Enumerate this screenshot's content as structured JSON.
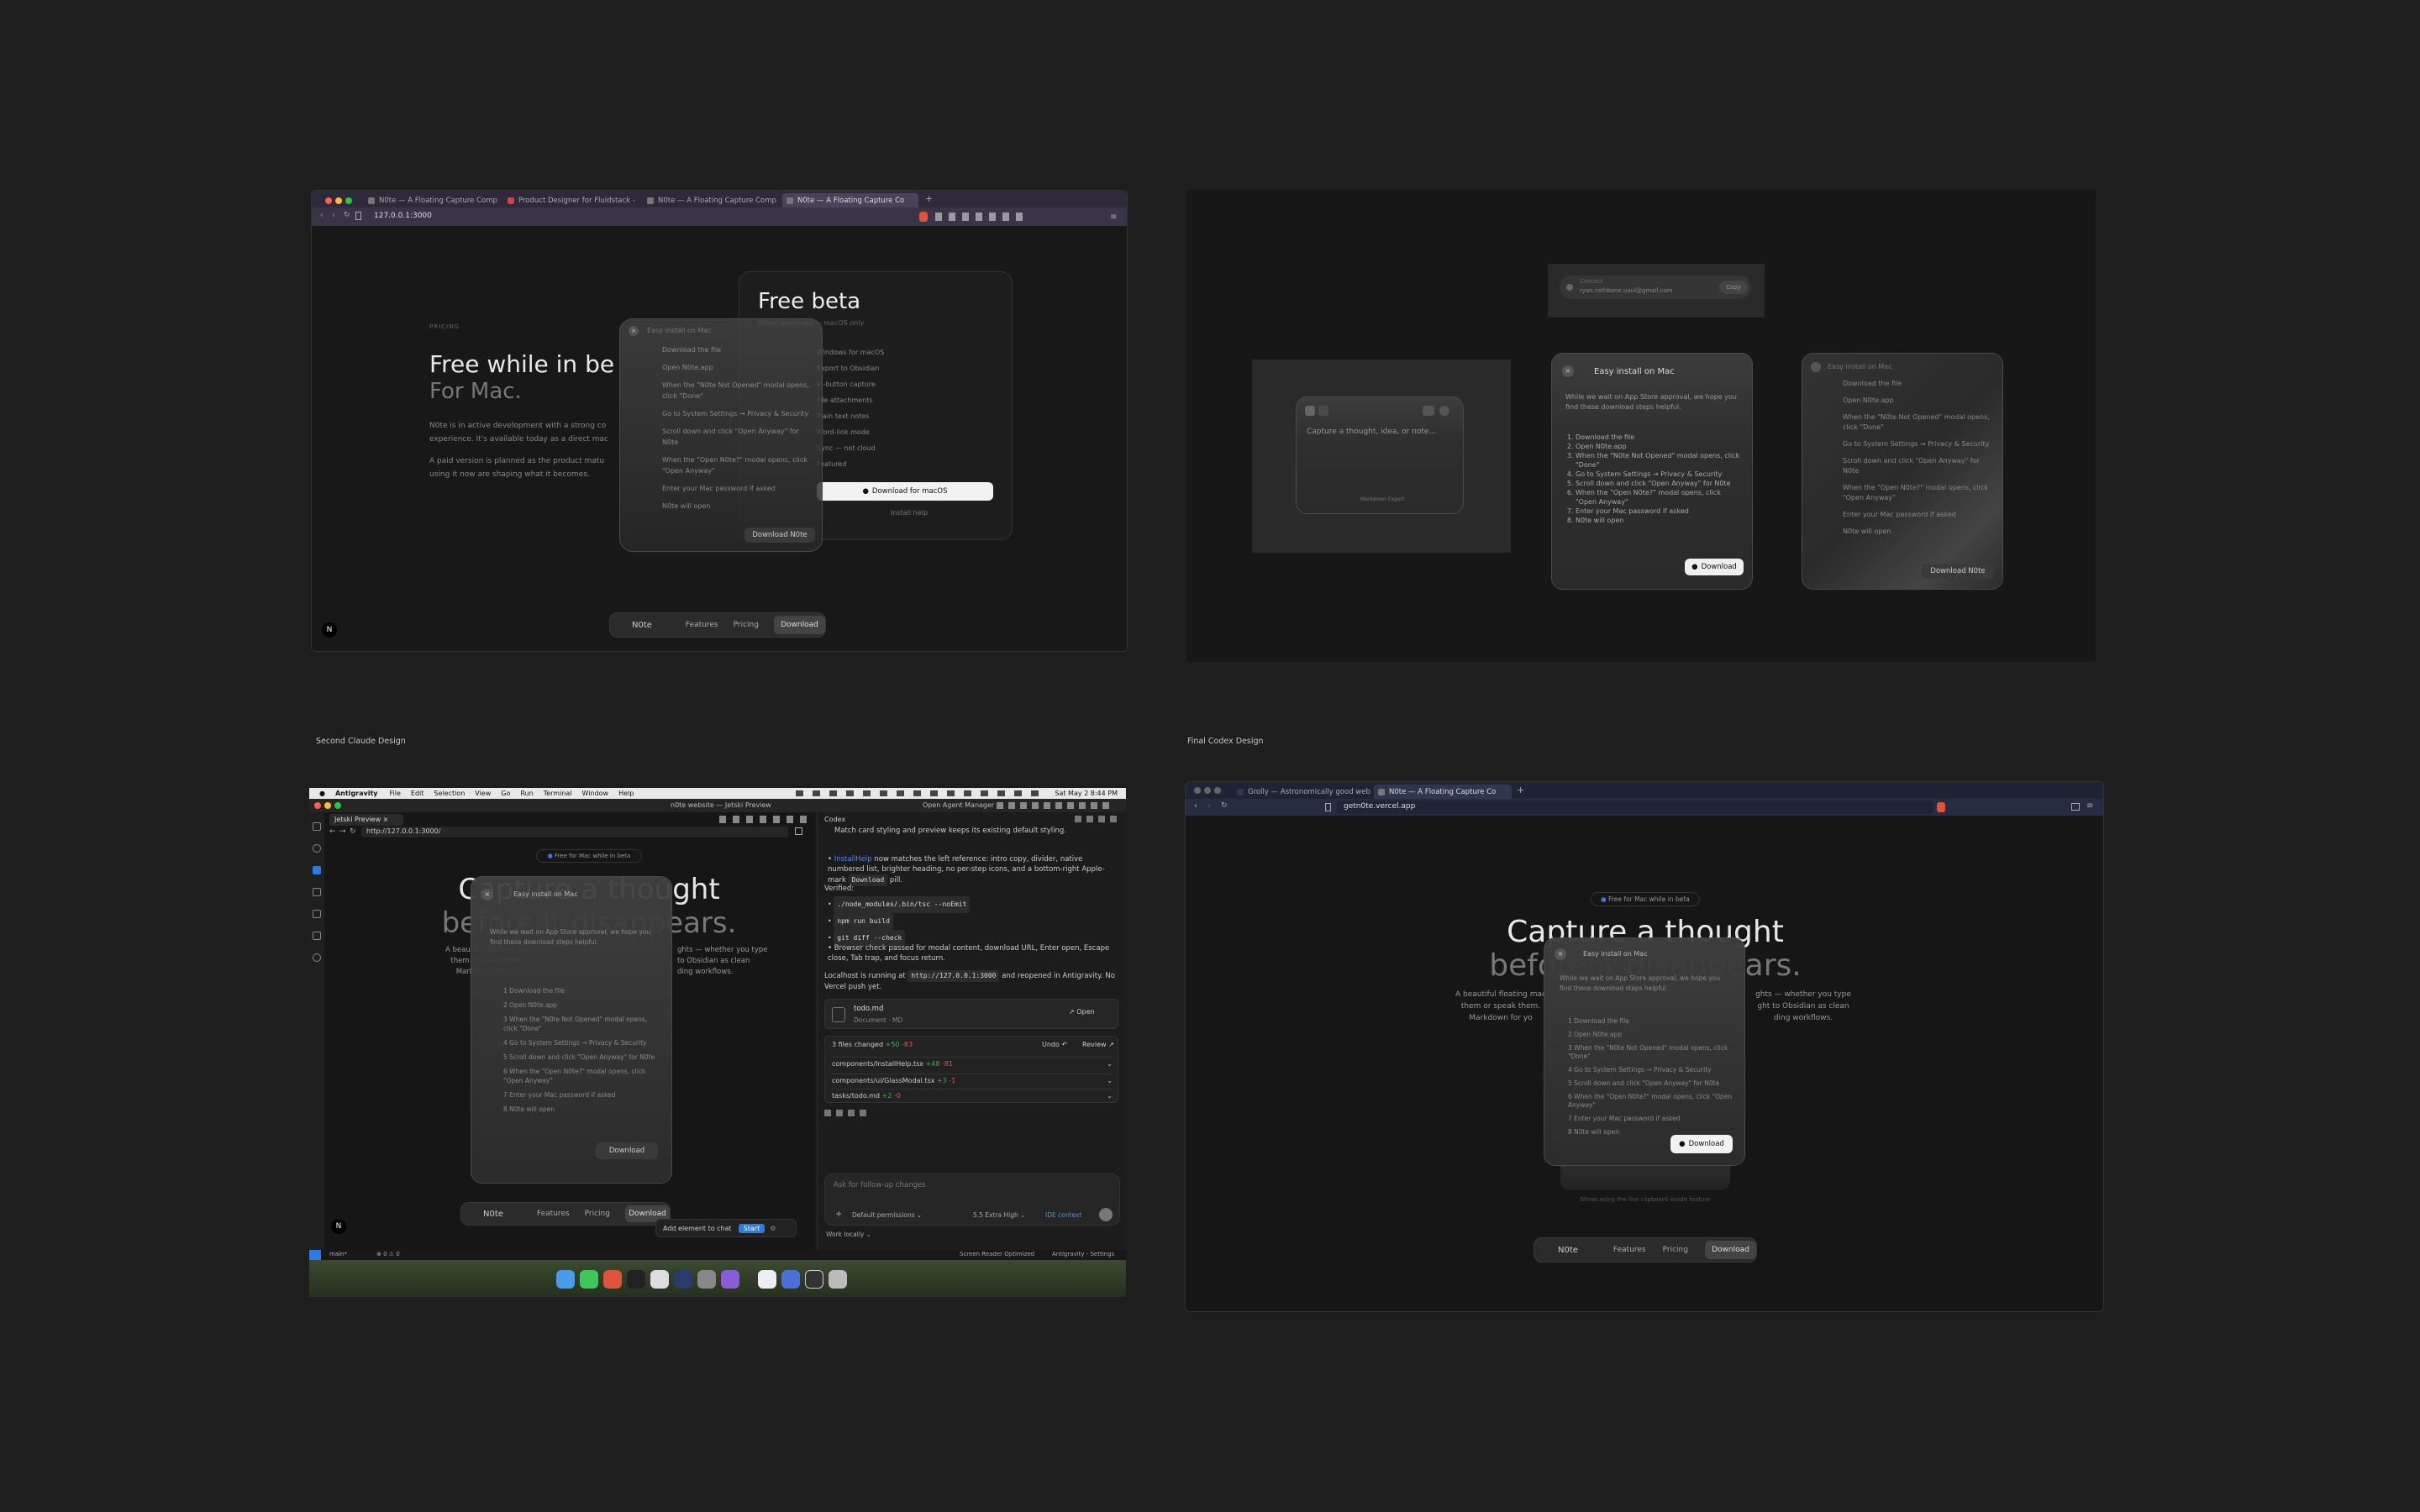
{
  "captions": {
    "second_claude": "Second Claude Design",
    "final_codex": "Final Codex Design"
  },
  "panel1": {
    "tabs": [
      "N0te — A Floating Capture Comp",
      "Product Designer for Fluidstack -",
      "N0te — A Floating Capture Comp",
      "N0te — A Floating Capture Co"
    ],
    "url": "127.0.0.1:3000",
    "eyebrow": "PRICING",
    "headline": "Free while in be",
    "subheadline": "For Mac.",
    "body1": "N0te is in active development with a strong co",
    "body1b": "experience. It's available today as a direct mac",
    "body2": "A paid version is planned as the product matu",
    "body2b": "using it now are shaping what it becomes.",
    "card_title": "Free beta",
    "card_sub": "Direct download — macOS only",
    "card_features": [
      "Windows for macOS",
      "Export to Obsidian",
      "In-button capture",
      "File attachments",
      "Plain text notes",
      "Word-link mode",
      "Sync — not cloud",
      "Featured"
    ],
    "card_download": "Download for macOS",
    "card_install": "Install help",
    "overlay_title": "Easy install on Mac",
    "overlay_steps": [
      "Download the file",
      "Open N0te.app",
      "When the \"N0te Not Opened\" modal opens, click \"Done\"",
      "Go to System Settings → Privacy & Security",
      "Scroll down and click \"Open Anyway\" for N0te",
      "When the \"Open N0te?\" modal opens, click \"Open Anyway\"",
      "Enter your Mac password if asked",
      "N0te will open"
    ],
    "overlay_button": "Download N0te",
    "nav": {
      "logo": "N0te",
      "features": "Features",
      "pricing": "Pricing",
      "download": "Download"
    },
    "badge": "N"
  },
  "panel2": {
    "email_label": "Contact",
    "email": "ryan.rathbone.uxui@gmail.com",
    "copy": "Copy",
    "capture_placeholder": "Capture a thought, idea, or note...",
    "capture_footer": "Markdown Export",
    "modal_title": "Easy install on Mac",
    "modal_intro": "While we wait on App Store approval, we hope you find these download steps helpful.",
    "modal_steps": [
      "Download the file",
      "Open N0te.app",
      "When the \"N0te Not Opened\" modal opens, click \"Done\"",
      "Go to System Settings → Privacy & Security",
      "Scroll down and click \"Open Anyway\" for N0te",
      "When the \"Open N0te?\" modal opens, click \"Open Anyway\"",
      "Enter your Mac password if asked",
      "N0te will open"
    ],
    "modal_button": "Download",
    "side_title": "Easy install on Mac",
    "side_steps": [
      "Download the file",
      "Open N0te.app",
      "When the \"N0te Not Opened\" modal opens, click \"Done\"",
      "Go to System Settings → Privacy & Security",
      "Scroll down and click \"Open Anyway\" for N0te",
      "When the \"Open N0te?\" modal opens, click \"Open Anyway\"",
      "Enter your Mac password if asked",
      "N0te will open"
    ],
    "side_button": "Download N0te"
  },
  "panel3": {
    "menubar": {
      "app": "Antigravity",
      "items": [
        "File",
        "Edit",
        "Selection",
        "View",
        "Go",
        "Run",
        "Terminal",
        "Window",
        "Help"
      ],
      "clock": "Sat May 2  8:44 PM"
    },
    "title": "n0te website — Jetski Preview",
    "agent_manager": "Open Agent Manager",
    "preview_tab": "Jetski Preview",
    "url": "http://127.0.0.1:3000/",
    "beta_pill": "Free for Mac while in beta",
    "hero1": "Capture a thought",
    "hero2": "before it disappears.",
    "hero_body": [
      "A beautiful floating mac",
      "them or speak them.",
      "Markdown for you"
    ],
    "hero_body_right": [
      "ghts — whether you type",
      "to Obsidian as clean",
      "ding workflows."
    ],
    "modal_title": "Easy install on Mac",
    "modal_intro": "While we wait on App Store approval, we hope you find these download steps helpful.",
    "modal_steps": [
      "1  Download the file",
      "2  Open N0te.app",
      "3  When the \"N0te Not Opened\" modal opens, click \"Done\"",
      "4  Go to System Settings → Privacy & Security",
      "5  Scroll down and click \"Open Anyway\" for N0te",
      "6  When the \"Open N0te?\" modal opens, click \"Open Anyway\"",
      "7  Enter your Mac password if asked",
      "8  N0te will open"
    ],
    "modal_button": "Download",
    "nav": {
      "logo": "N0te",
      "features": "Features",
      "pricing": "Pricing",
      "download": "Download"
    },
    "add_to_chat": "Add element to chat",
    "start": "Start",
    "chat_title": "Codex",
    "chat_p1": "Match card styling and preview keeps its existing default styling.",
    "chat_p2a": "InstallHelp",
    "chat_p2b": " now matches the left reference: intro copy, divider, native numbered list, brighter heading, no per-step icons, and a bottom-right Apple-mark ",
    "chat_p2c": "Download",
    "chat_p2d": " pill.",
    "verified": "Verified:",
    "checks": [
      "./node_modules/.bin/tsc --noEmit",
      "npm run build",
      "git diff --check"
    ],
    "browser_check": "Browser check passed for modal content, download URL, Enter open, Escape close, Tab trap, and focus return.",
    "localhost_a": "Localhost is running at ",
    "localhost_url": "http://127.0.0.1:3000",
    "localhost_b": " and reopened in Antigravity. No Vercel push yet.",
    "file_name": "todo.md",
    "file_type": "Document · MD",
    "open": "Open",
    "files_changed": "3 files changed",
    "plus": "+50",
    "minus": "-83",
    "undo": "Undo",
    "review": "Review",
    "changed_files": [
      {
        "name": "components/InstallHelp.tsx",
        "add": "+48",
        "del": "-81"
      },
      {
        "name": "components/ui/GlassModal.tsx",
        "add": "+3",
        "del": "-1"
      },
      {
        "name": "tasks/todo.md",
        "add": "+2",
        "del": "-0"
      }
    ],
    "input_placeholder": "Ask for follow-up changes",
    "permissions": "Default permissions",
    "model": "5.5  Extra High",
    "ide_context": "IDE context",
    "work_locally": "Work locally",
    "status_left": "main*",
    "status_counts": "⊗ 0 ⚠ 0",
    "status_right1": "Screen Reader Optimized",
    "status_right2": "Antigravity - Settings"
  },
  "panel4": {
    "tabs": [
      "Grolly — Astronomically good web...",
      "N0te — A Floating Capture Co"
    ],
    "url": "getn0te.vercel.app",
    "beta_pill": "Free for Mac while in beta",
    "hero1": "Capture a thought",
    "hero2": "before it disappears.",
    "hero_body_left": [
      "A beautiful floating mac",
      "them or speak them.",
      "Markdown for yo"
    ],
    "hero_body_right": [
      "ghts — whether you type",
      "ght to Obsidian as clean",
      "ding workflows."
    ],
    "modal_title": "Easy install on Mac",
    "modal_intro": "While we wait on App Store approval, we hope you find these download steps helpful.",
    "modal_steps": [
      "1  Download the file",
      "2  Open N0te.app",
      "3  When the \"N0te Not Opened\" modal opens, click \"Done\"",
      "4  Go to System Settings → Privacy & Security",
      "5  Scroll down and click \"Open Anyway\" for N0te",
      "6  When the \"Open N0te?\" modal opens, click \"Open Anyway\"",
      "7  Enter your Mac password if asked",
      "8  N0te will open"
    ],
    "modal_button": "Download",
    "below_caption": "Showcasing the live clipboard inside feature",
    "nav": {
      "logo": "N0te",
      "features": "Features",
      "pricing": "Pricing",
      "download": "Download"
    }
  }
}
